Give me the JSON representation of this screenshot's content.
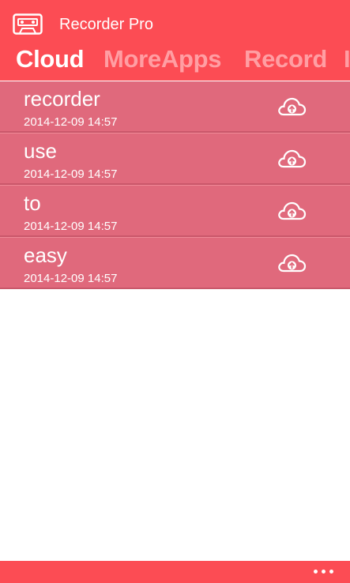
{
  "app": {
    "title": "Recorder Pro",
    "icon": "cassette-tape-icon",
    "accent_color": "#fc4c54",
    "row_color": "#e0697c"
  },
  "pivot": {
    "tabs": [
      {
        "label": "Cloud",
        "active": true
      },
      {
        "label": "MoreApps",
        "active": false
      },
      {
        "label": "Record",
        "active": false
      },
      {
        "label": "I",
        "active": false
      }
    ]
  },
  "recordings": [
    {
      "title": "recorder",
      "date": "2014-12-09 14:57",
      "action_icon": "cloud-upload-icon"
    },
    {
      "title": "use",
      "date": "2014-12-09 14:57",
      "action_icon": "cloud-upload-icon"
    },
    {
      "title": "to",
      "date": "2014-12-09 14:57",
      "action_icon": "cloud-upload-icon"
    },
    {
      "title": "easy",
      "date": "2014-12-09 14:57",
      "action_icon": "cloud-upload-icon"
    }
  ],
  "appbar": {
    "more_icon": "ellipsis-icon"
  }
}
